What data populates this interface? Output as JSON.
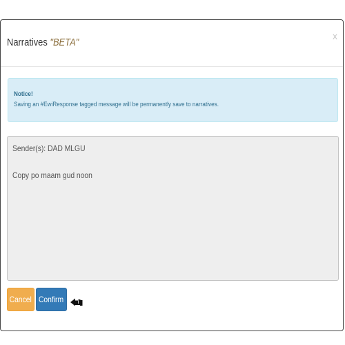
{
  "modal": {
    "title_prefix": "Narratives ",
    "title_beta": "\"BETA\"",
    "close_label": "x"
  },
  "notice": {
    "title": "Notice!",
    "text": "Saving an #EwiResponse tagged message will be permanently save to narratives."
  },
  "narrative": {
    "sender": "Sender(s): DAD MLGU",
    "message": "Copy po maam gud noon"
  },
  "actions": {
    "cancel_label": "Cancel",
    "confirm_label": "Confirm"
  },
  "icons": {
    "pointer": "pointing-hand-icon"
  },
  "colors": {
    "notice_background": "#d9edf7",
    "notice_text": "#31708f",
    "cancel_button": "#f0ad4e",
    "confirm_button": "#337ab7",
    "beta_text": "#8a6d3b"
  }
}
